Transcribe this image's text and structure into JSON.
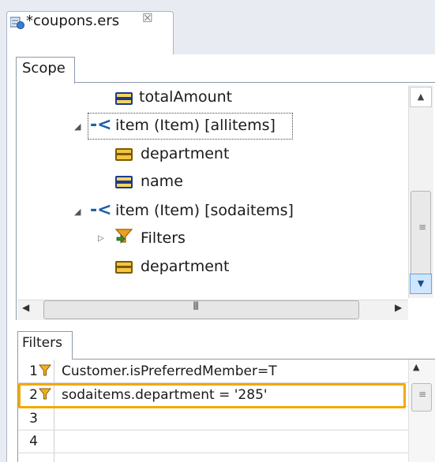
{
  "editor_tab": {
    "title": "*coupons.ers",
    "close_glyph": "☒"
  },
  "scope": {
    "tab_label": "Scope",
    "tree": [
      {
        "label": "totalAmount",
        "icon": "field-icon-blue"
      },
      {
        "label": "item (Item) [allitems]",
        "icon": "association-icon",
        "expanded": true,
        "selected": true
      },
      {
        "label": "department",
        "icon": "field-icon-gold"
      },
      {
        "label": "name",
        "icon": "field-icon-blue"
      },
      {
        "label": "item (Item) [sodaitems]",
        "icon": "association-icon",
        "expanded": true
      },
      {
        "label": "Filters",
        "icon": "filter-icon",
        "expanded": false
      },
      {
        "label": "department",
        "icon": "field-icon-gold"
      }
    ],
    "hscroll_grip": "III"
  },
  "filters": {
    "tab_label": "Filters",
    "rows": [
      {
        "num": "1",
        "expr": "Customer.isPreferredMember=T",
        "has_icon": true
      },
      {
        "num": "2",
        "expr": "sodaitems.department = '285'",
        "has_icon": true,
        "highlighted": true
      },
      {
        "num": "3",
        "expr": "",
        "has_icon": false
      },
      {
        "num": "4",
        "expr": "",
        "has_icon": false
      }
    ]
  },
  "colors": {
    "highlight": "#f2a900",
    "association_blue": "#1e5fa8",
    "field_gold": "#f5c542"
  }
}
